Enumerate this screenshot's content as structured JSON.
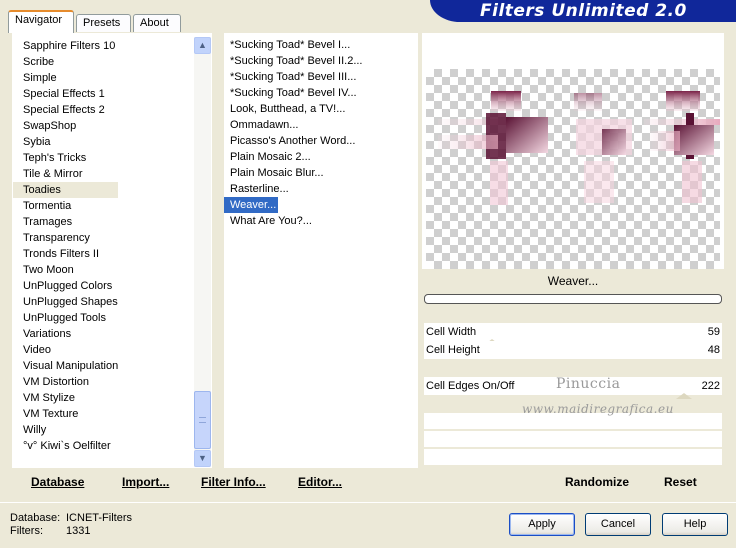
{
  "window": {
    "banner_title": "Filters Unlimited 2.0"
  },
  "tabs": [
    {
      "label": "Navigator",
      "active": true
    },
    {
      "label": "Presets",
      "active": false
    },
    {
      "label": "About",
      "active": false
    }
  ],
  "categories": {
    "items": [
      "Sapphire Filters 10",
      "Scribe",
      "Simple",
      "Special Effects 1",
      "Special Effects 2",
      "SwapShop",
      "Sybia",
      "Teph's Tricks",
      "Tile & Mirror",
      "Toadies",
      "Tormentia",
      "Tramages",
      "Transparency",
      "Tronds Filters II",
      "Two Moon",
      "UnPlugged Colors",
      "UnPlugged Shapes",
      "UnPlugged Tools",
      "Variations",
      "Video",
      "Visual Manipulation",
      "VM Distortion",
      "VM Stylize",
      "VM Texture",
      "Willy",
      "°v° Kiwi`s Oelfilter"
    ],
    "selected": "Toadies"
  },
  "filters": {
    "items": [
      "*Sucking Toad*  Bevel I...",
      "*Sucking Toad*  Bevel II.2...",
      "*Sucking Toad*  Bevel III...",
      "*Sucking Toad*  Bevel IV...",
      "Look, Butthead, a TV!...",
      "Ommadawn...",
      "Picasso's Another Word...",
      "Plain Mosaic 2...",
      "Plain Mosaic Blur...",
      "Rasterline...",
      "Weaver...",
      "What Are You?..."
    ],
    "selected": "Weaver..."
  },
  "preview": {
    "filter_name": "Weaver...",
    "progress": 0
  },
  "params": [
    {
      "name": "Cell Width",
      "value": "59"
    },
    {
      "name": "Cell Height",
      "value": "48"
    },
    {
      "name": "Cell Edges On/Off",
      "value": "222"
    }
  ],
  "watermark": {
    "line1": "Pinuccia",
    "line2": "www.maidiregrafica.eu"
  },
  "actions": {
    "database": "Database",
    "import": "Import...",
    "filter_info": "Filter Info...",
    "editor": "Editor...",
    "randomize": "Randomize",
    "reset": "Reset"
  },
  "status": {
    "database_label": "Database:",
    "database_value": "ICNET-Filters",
    "filters_label": "Filters:",
    "filters_value": "1331"
  },
  "dialog_buttons": {
    "apply": "Apply",
    "cancel": "Cancel",
    "help": "Help"
  },
  "colors": {
    "banner": "#10279a",
    "selection": "#316ac5",
    "background": "#ece9d8",
    "preview_tint": "#6b1f44"
  },
  "icons": {
    "scroll_up": "chevron-up-icon",
    "scroll_down": "chevron-down-icon"
  }
}
